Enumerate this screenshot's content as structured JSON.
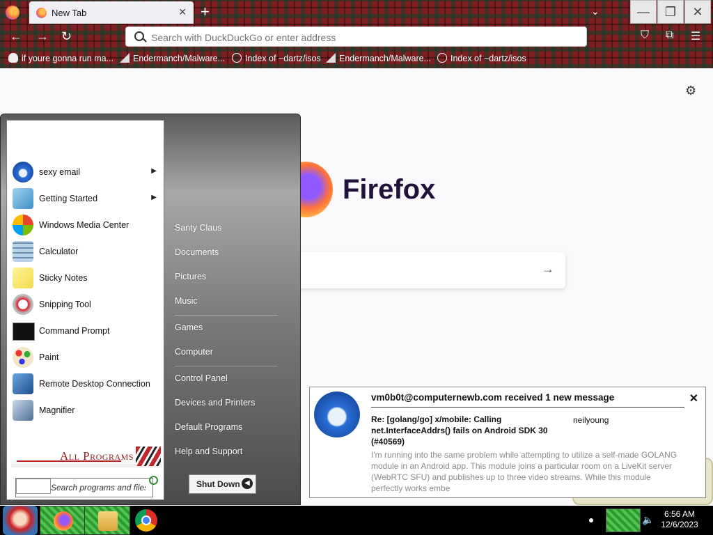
{
  "browser": {
    "tab": {
      "title": "New Tab"
    },
    "urlbar": {
      "placeholder": "Search with DuckDuckGo or enter address"
    },
    "bookmarks": [
      {
        "label": "if youre gonna run ma...",
        "icon": "skull-icon"
      },
      {
        "label": "Endermanch/Malware...",
        "icon": "page-icon"
      },
      {
        "label": "Index of ~dartz/isos",
        "icon": "globe-icon"
      },
      {
        "label": "Endermanch/Malware...",
        "icon": "page-icon"
      },
      {
        "label": "Index of ~dartz/isos",
        "icon": "globe-icon"
      }
    ]
  },
  "newtab": {
    "wordmark": "Firefox"
  },
  "startmenu": {
    "programs": [
      {
        "label": "sexy email",
        "icon": "thunderbird-icon",
        "submenu": true
      },
      {
        "label": "Getting Started",
        "icon": "getting-started-icon",
        "submenu": true
      },
      {
        "label": "Windows Media Center",
        "icon": "media-center-icon",
        "submenu": false
      },
      {
        "label": "Calculator",
        "icon": "calculator-icon",
        "submenu": false
      },
      {
        "label": "Sticky Notes",
        "icon": "sticky-notes-icon",
        "submenu": false
      },
      {
        "label": "Snipping Tool",
        "icon": "snipping-tool-icon",
        "submenu": false
      },
      {
        "label": "Command Prompt",
        "icon": "command-prompt-icon",
        "submenu": false
      },
      {
        "label": "Paint",
        "icon": "paint-icon",
        "submenu": false
      },
      {
        "label": "Remote Desktop Connection",
        "icon": "remote-desktop-icon",
        "submenu": false
      },
      {
        "label": "Magnifier",
        "icon": "magnifier-icon",
        "submenu": false
      }
    ],
    "all_programs": "All Programs",
    "search_placeholder": "Search programs and files",
    "places": [
      "Santy Claus",
      "Documents",
      "Pictures",
      "Music",
      "Games",
      "Computer",
      "Control Panel",
      "Devices and Printers",
      "Default Programs",
      "Help and Support"
    ],
    "shutdown_label": "Shut Down"
  },
  "notification": {
    "heading": "vm0b0t@computernewb.com received 1 new message",
    "subject": "Re: [golang/go] x/mobile: Calling net.InterfaceAddrs() fails on Android SDK 30 (#40569)",
    "sender": "neilyoung",
    "preview": "I'm running into the same problem while attempting to utilize a self-made GOLANG module in an Android app. This module joins a particular room on a LiveKit server (WebRTC SFU) and publishes up to three video streams. While this module perfectly works embe"
  },
  "taskbar": {
    "clock_time": "6:56 AM",
    "clock_date": "12/6/2023"
  },
  "colors": {
    "start_menu_bg": "#787878",
    "all_programs_red": "#9b1b1b",
    "taskbar_green": "#2c9a2c"
  }
}
